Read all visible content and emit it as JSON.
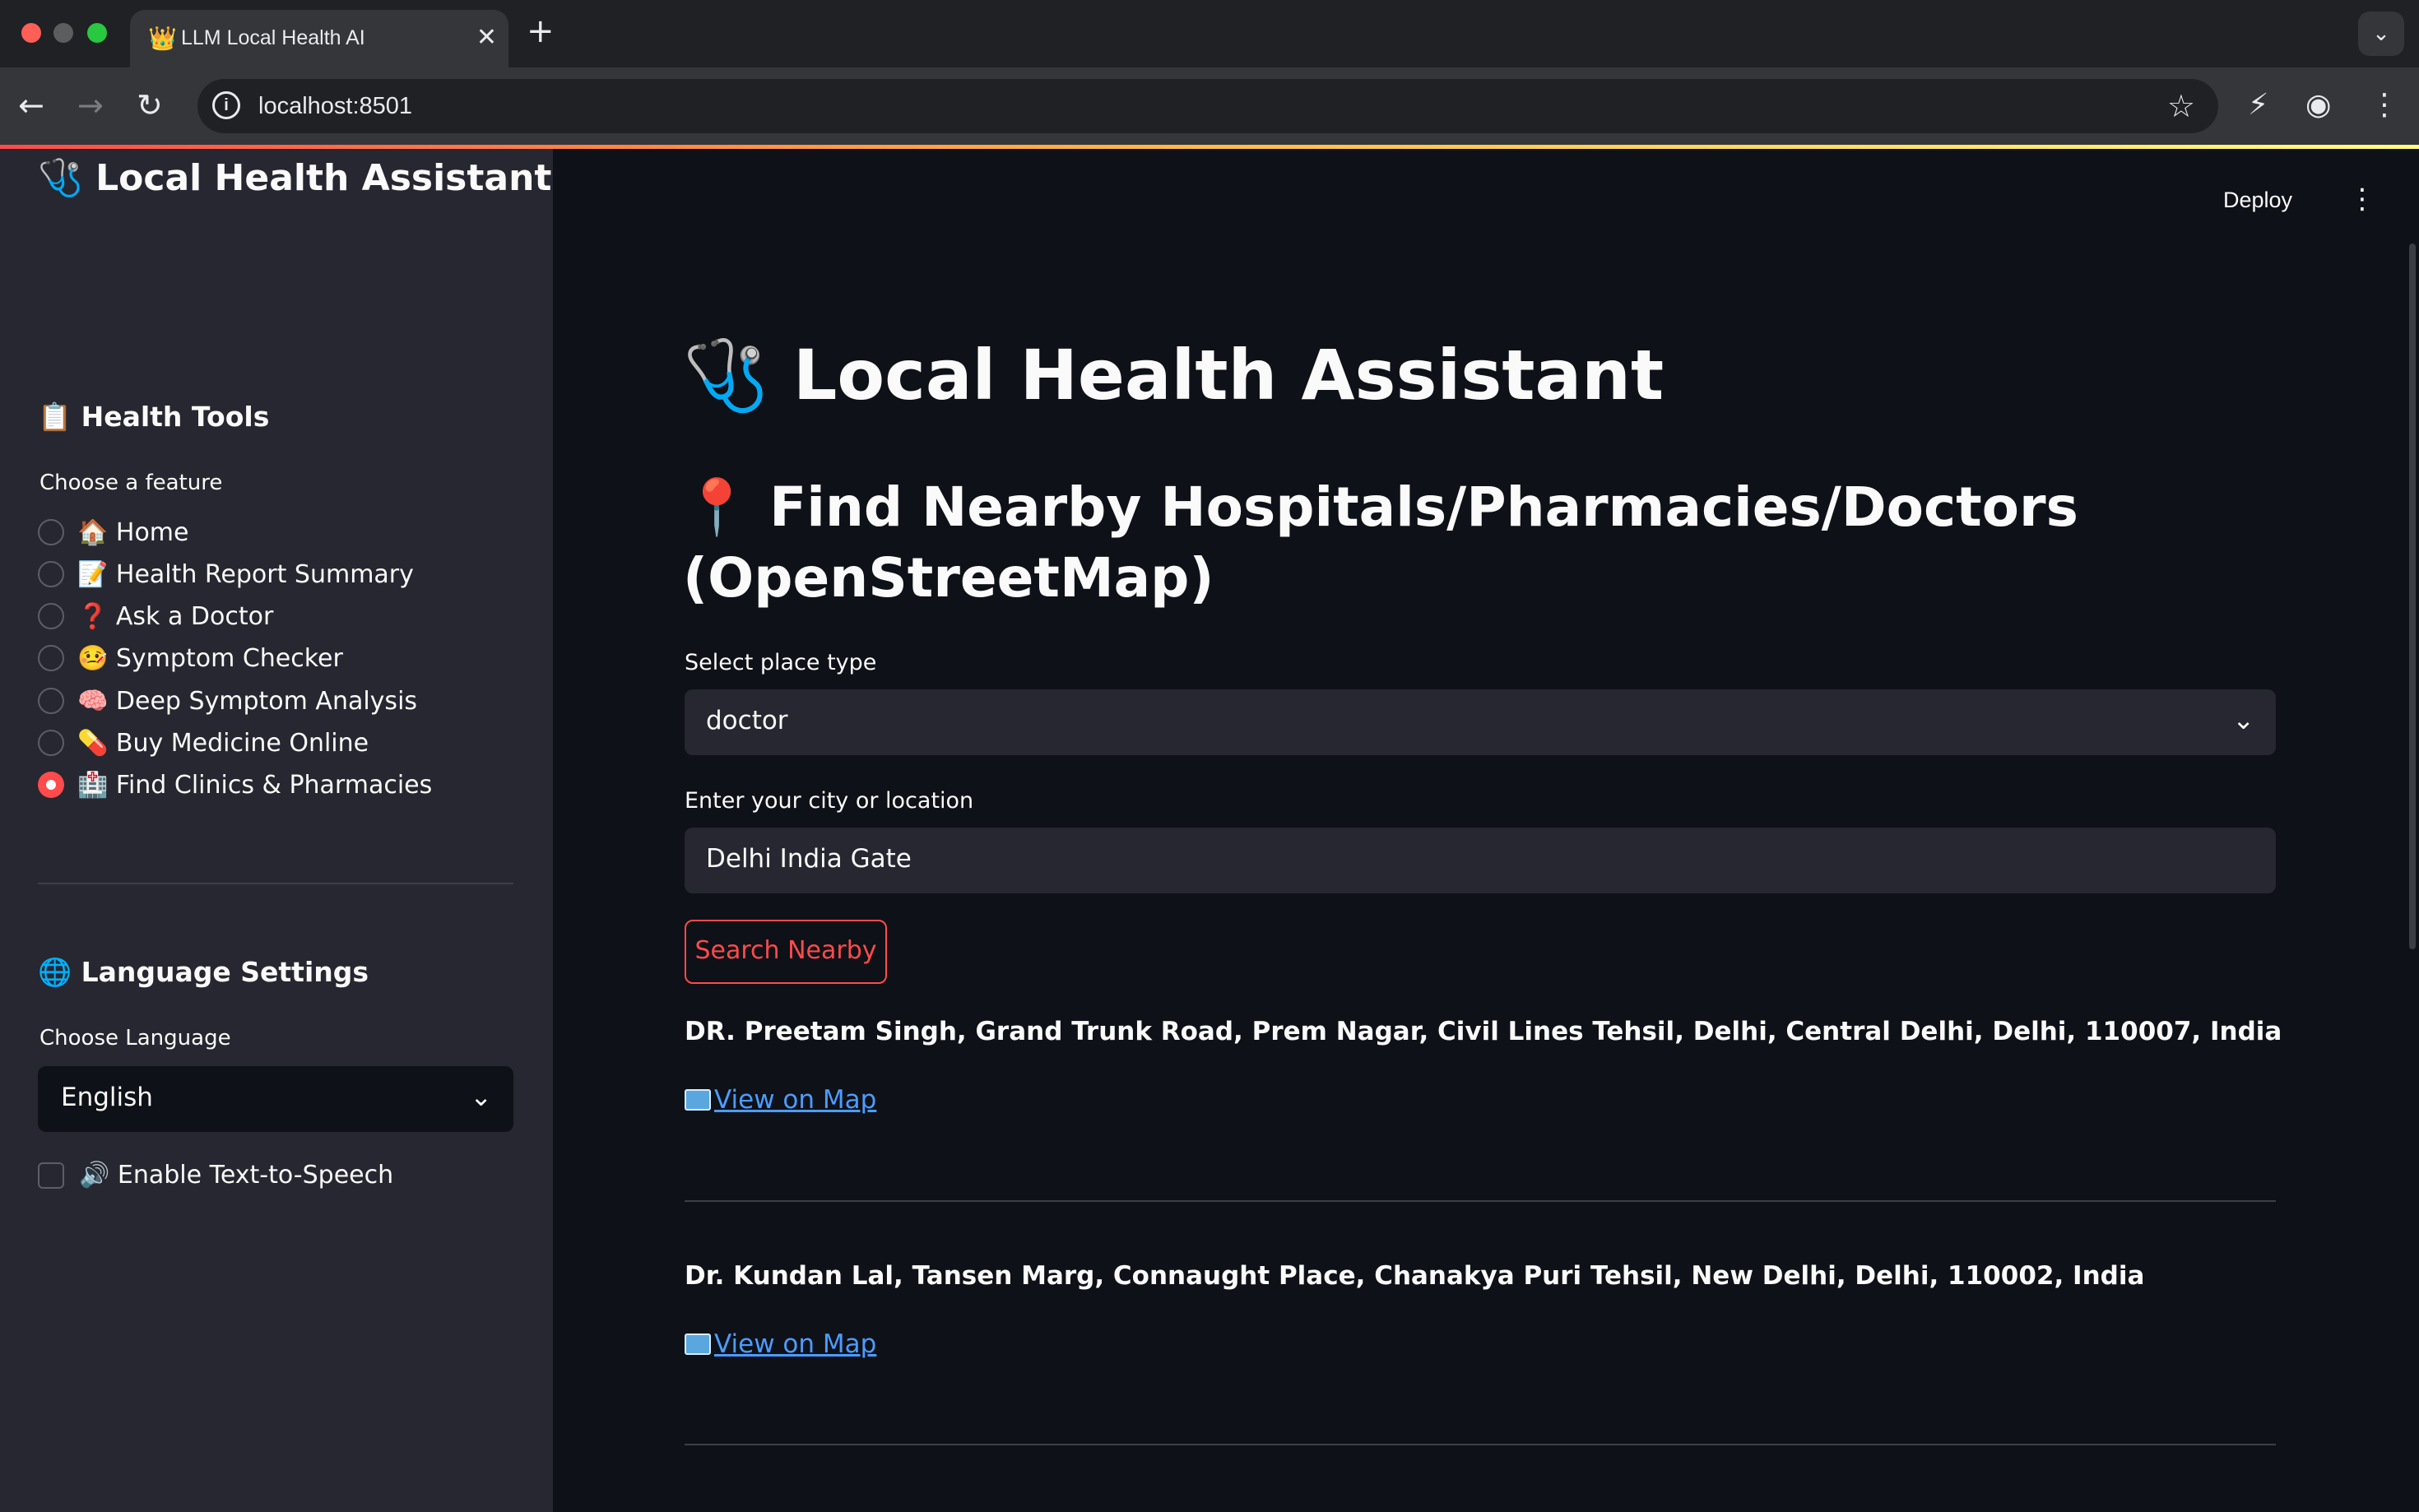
{
  "browser": {
    "tab_title": "LLM Local Health AI",
    "tab_favicon": "👑",
    "url": "localhost:8501",
    "icons": [
      "back-icon",
      "forward-icon",
      "reload-icon",
      "info-icon",
      "star-icon",
      "extension-icon",
      "profile-icon",
      "menu-icon"
    ]
  },
  "app": {
    "deploy_label": "Deploy",
    "accent_color": "#ff4b4b"
  },
  "sidebar": {
    "title": "🩺 Local Health Assistant",
    "tools_heading": "📋 Health Tools",
    "feature_label": "Choose a feature",
    "features": [
      {
        "label": "🏠 Home",
        "selected": false
      },
      {
        "label": "📝 Health Report Summary",
        "selected": false
      },
      {
        "label": "❓ Ask a Doctor",
        "selected": false
      },
      {
        "label": "🤒 Symptom Checker",
        "selected": false
      },
      {
        "label": "🧠 Deep Symptom Analysis",
        "selected": false
      },
      {
        "label": "💊 Buy Medicine Online",
        "selected": false
      },
      {
        "label": "🏥 Find Clinics & Pharmacies",
        "selected": true
      }
    ],
    "language_heading": "🌐 Language Settings",
    "language_label": "Choose Language",
    "language_value": "English",
    "tts_label": "🔊 Enable Text-to-Speech",
    "tts_checked": false
  },
  "main": {
    "title": "🩺 Local Health Assistant",
    "subtitle": "📍 Find Nearby Hospitals/Pharmacies/Doctors (OpenStreetMap)",
    "place_type_label": "Select place type",
    "place_type_value": "doctor",
    "location_label": "Enter your city or location",
    "location_value": "Delhi India Gate",
    "search_button": "Search Nearby",
    "results": [
      {
        "address": "DR. Preetam Singh, Grand Trunk Road, Prem Nagar, Civil Lines Tehsil, Delhi, Central Delhi, Delhi, 110007, India",
        "link": "View on Map"
      },
      {
        "address": "Dr. Kundan Lal, Tansen Marg, Connaught Place, Chanakya Puri Tehsil, New Delhi, Delhi, 110002, India",
        "link": "View on Map"
      }
    ]
  }
}
